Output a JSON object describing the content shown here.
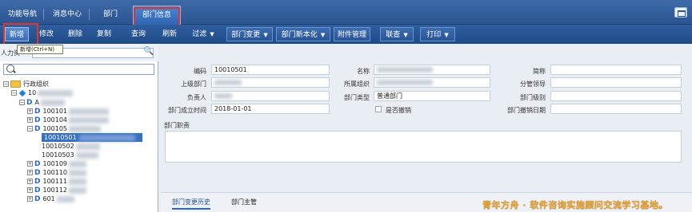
{
  "tabs": [
    "功能导航",
    "消息中心",
    "部门",
    "部门信息"
  ],
  "toolbar": {
    "add": "新增",
    "edit": "修改",
    "delete": "删除",
    "copy": "复制",
    "query": "查询",
    "refresh": "刷新",
    "filter": "过滤",
    "dept_change": "部门变更",
    "dept_localize": "部门新本化",
    "attachments": "附件管理",
    "link_query": "联查",
    "print": "打印"
  },
  "tooltip": "新增(Ctrl+N)",
  "left_panel": {
    "header_label": "人力资",
    "tree": {
      "root": "行政组织",
      "nodes": [
        "10",
        "A",
        "100101",
        "100104",
        "100105",
        "10010501",
        "10010502",
        "10010503",
        "100109",
        "100110",
        "100111",
        "100112",
        "601"
      ]
    }
  },
  "form": {
    "code_label": "编码",
    "code_value": "10010501",
    "name_label": "名称",
    "short_label": "简称",
    "parent_label": "上级部门",
    "org_label": "所属组织",
    "leader_label": "分管领导",
    "owner_label": "负责人",
    "type_label": "部门类型",
    "type_value": "普通部门",
    "level_label": "部门级别",
    "established_label": "部门成立时间",
    "established_value": "2018-01-01",
    "revoked_label": "是否撤销",
    "revoke_date_label": "部门撤销日期",
    "duty_label": "部门职责"
  },
  "bottom_tabs": [
    "部门变更历史",
    "部门主管"
  ],
  "watermark": "青年方舟 · 软件咨询实施顾问交流学习基地。",
  "colors": {
    "accent": "#2b5591",
    "highlight": "#e0352b",
    "selected": "#3570c2"
  },
  "icons": [
    "search-icon",
    "folder-icon",
    "dept-icon",
    "window-restore-icon"
  ]
}
